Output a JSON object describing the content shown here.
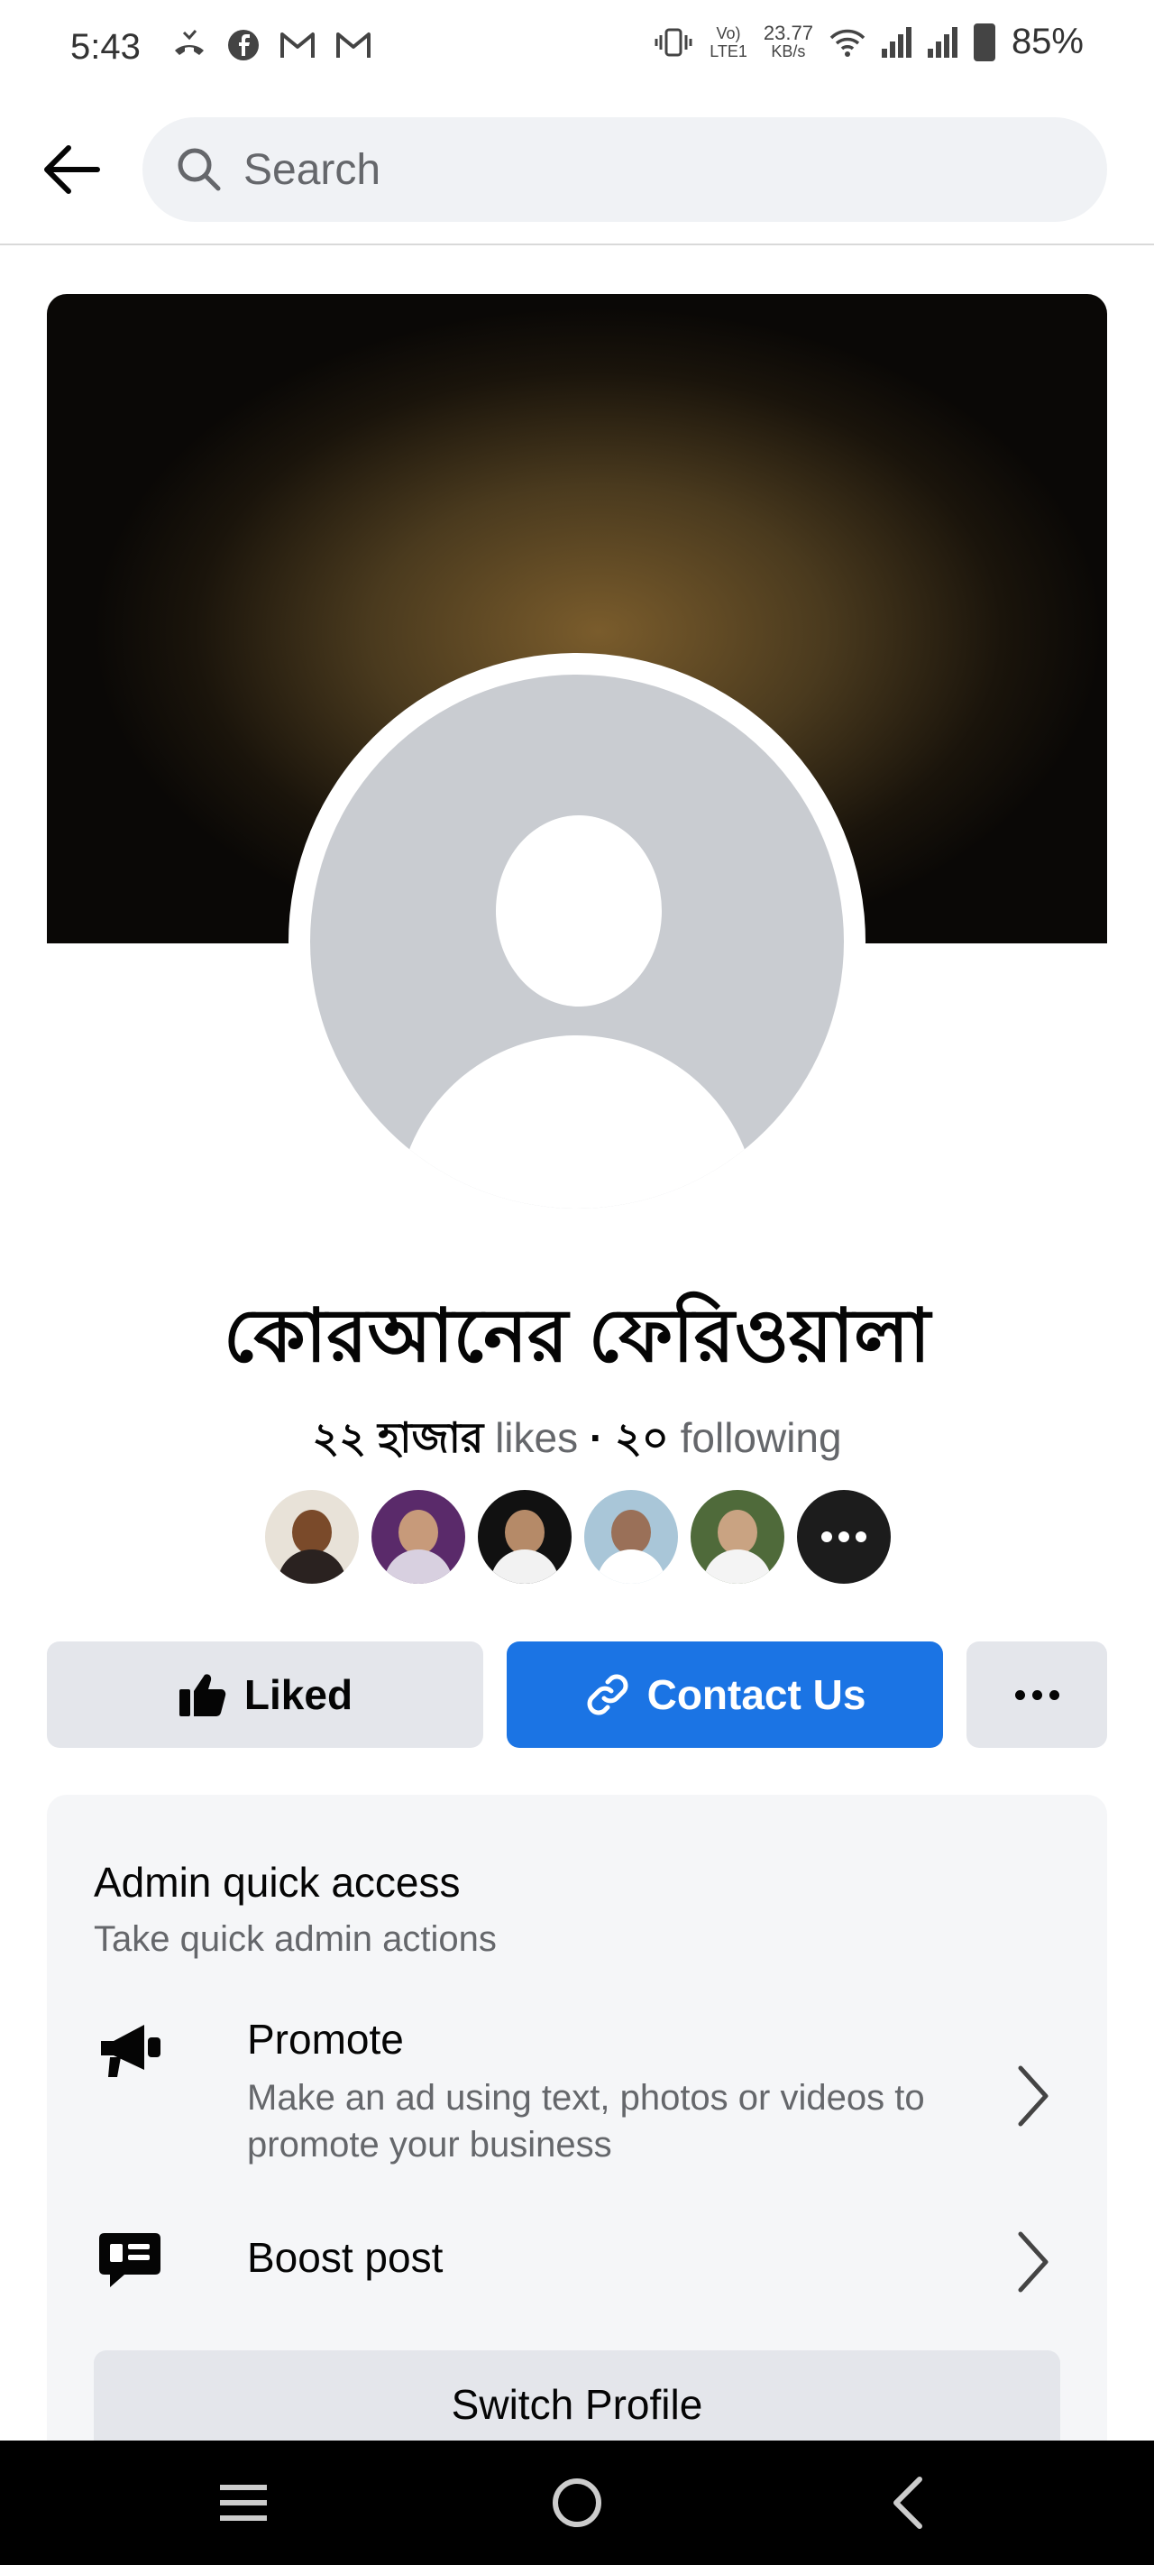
{
  "status_bar": {
    "time": "5:43",
    "notification_icons": [
      "missed-call-icon",
      "facebook-icon",
      "gmail-icon",
      "gmail-icon"
    ],
    "network_label_top": "Vo)",
    "network_label_bottom": "LTE1",
    "speed_value": "23.77",
    "speed_unit": "KB/s",
    "battery": "85%"
  },
  "header": {
    "search_placeholder": "Search"
  },
  "profile": {
    "name": "কোরআনের ফেরিওয়ালা",
    "likes_count": "২২ হাজার",
    "likes_label": "likes",
    "separator": "·",
    "following_count": "২০",
    "following_label": "following"
  },
  "actions": {
    "liked_label": "Liked",
    "contact_label": "Contact Us"
  },
  "admin_quick_access": {
    "title": "Admin quick access",
    "subtitle": "Take quick admin actions",
    "items": [
      {
        "title": "Promote",
        "description": "Make an ad using text, photos or videos to promote your business"
      },
      {
        "title": "Boost post",
        "description": ""
      }
    ],
    "switch_label": "Switch Profile"
  },
  "colors": {
    "primary": "#1b74e4",
    "secondary_button": "#e4e6eb",
    "card_background": "#f5f6f8",
    "muted_text": "#65676b"
  }
}
